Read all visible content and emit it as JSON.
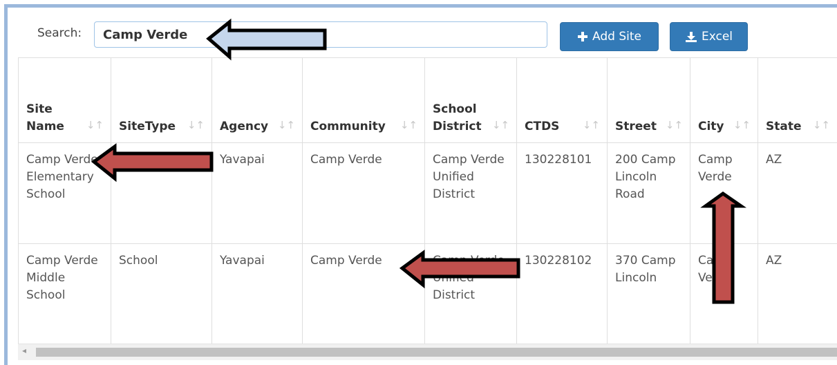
{
  "search": {
    "label": "Search:",
    "value": "Camp Verde"
  },
  "buttons": {
    "add_site": "Add Site",
    "excel": "Excel"
  },
  "icons": {
    "add": "plus-icon",
    "excel": "download-icon",
    "sort": "sort-icon"
  },
  "colors": {
    "button": "#337ab7",
    "frame": "#9bb8dc",
    "arrow_red": "#c0504d",
    "arrow_blue": "#c5d6ec"
  },
  "table": {
    "headers": [
      {
        "line1": "Site",
        "line2": "Name"
      },
      {
        "line1": "",
        "line2": "SiteType"
      },
      {
        "line1": "",
        "line2": "Agency"
      },
      {
        "line1": "",
        "line2": "Community"
      },
      {
        "line1": "School",
        "line2": "District"
      },
      {
        "line1": "",
        "line2": "CTDS"
      },
      {
        "line1": "",
        "line2": "Street"
      },
      {
        "line1": "",
        "line2": "City"
      },
      {
        "line1": "",
        "line2": "State"
      }
    ],
    "sort_glyph": "↓↑",
    "rows": [
      [
        "Camp Verde Elementary School",
        "",
        "Yavapai",
        "Camp Verde",
        "Camp Verde Unified District",
        "130228101",
        "200 Camp Lincoln Road",
        "Camp Verde",
        "AZ"
      ],
      [
        "Camp Verde Middle School",
        "School",
        "Yavapai",
        "Camp Verde",
        "Camp Verde Unified District",
        "130228102",
        "370 Camp Lincoln",
        "Camp Verde",
        "AZ"
      ]
    ]
  },
  "scroll": {
    "left_arrow": "◂"
  }
}
